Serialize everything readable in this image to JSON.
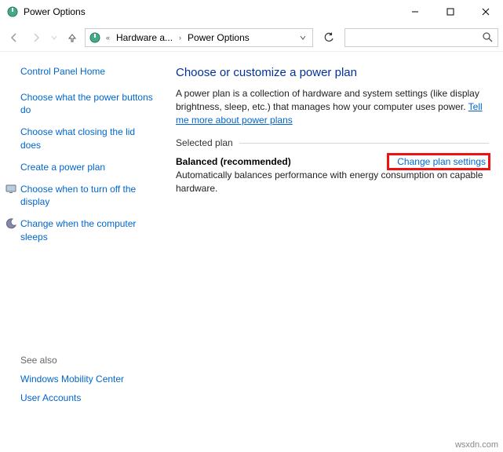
{
  "title": "Power Options",
  "breadcrumb": {
    "level1": "Hardware a...",
    "level2": "Power Options"
  },
  "sidebar": {
    "home": "Control Panel Home",
    "tasks": [
      "Choose what the power buttons do",
      "Choose what closing the lid does",
      "Create a power plan",
      "Choose when to turn off the display",
      "Change when the computer sleeps"
    ],
    "seealso_label": "See also",
    "seealso": [
      "Windows Mobility Center",
      "User Accounts"
    ]
  },
  "main": {
    "heading": "Choose or customize a power plan",
    "desc_pre": "A power plan is a collection of hardware and system settings (like display brightness, sleep, etc.) that manages how your computer uses power. ",
    "desc_link": "Tell me more about power plans",
    "selected_label": "Selected plan",
    "plan_name": "Balanced (recommended)",
    "plan_desc": "Automatically balances performance with energy consumption on capable hardware.",
    "change_link": "Change plan settings"
  },
  "watermark": "wsxdn.com"
}
